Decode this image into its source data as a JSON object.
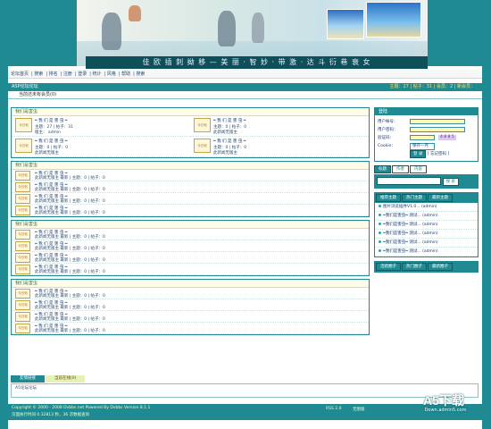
{
  "banner": {
    "slogan": "佳 欧 插 刺 拗 移 — 美 丽 · 智 妙 · 带 激 · 达 斗 衍 巷 衰 女"
  },
  "nav": {
    "items": [
      "论坛首页",
      "搜索",
      "排名",
      "注册",
      "登录",
      "统计",
      "风格",
      "帮助",
      "搜索"
    ]
  },
  "stats": {
    "text": "主题：27  |  帖子：31  |  会员：2  |  新会员："
  },
  "forum_bar": {
    "title": "ASP论坛论坛",
    "right": "今日：0  |  帖：28  |  最高日：40"
  },
  "online": {
    "text": "当前还未有会员(0)"
  },
  "sections": [
    {
      "title": "我们是害虫",
      "type": "grid",
      "cells": [
        {
          "icon": "今日帖",
          "title": "═ 我 们 是 害 虫 ═",
          "line2": "主题：27  |  帖子：31",
          "line3": "版主：  admin"
        },
        {
          "icon": "今日帖",
          "title": "═ 我 们 是 害 虫 ═",
          "line2": "主题：0  |  帖子：0",
          "line3": "此新闻无版主"
        },
        {
          "icon": "今日帖",
          "title": "═ 我 们 是 害 虫 ═",
          "line2": "主题：0  |  帖子：0",
          "line3": "此新闻无版主"
        },
        {
          "icon": "今日帖",
          "title": "═ 我 们 是 害 虫 ═",
          "line2": "主题：0  |  帖子：0",
          "line3": "此新闻无版主"
        }
      ]
    },
    {
      "title": "我们是害虫",
      "type": "rows",
      "rows": [
        {
          "icon": "今日帖",
          "title": "═ 我 们 是 害 虫 ═",
          "line2": "此新闻无版主    最新  |  主题：0  |  帖子：0"
        },
        {
          "icon": "今日帖",
          "title": "═ 我 们 是 害 虫 ═",
          "line2": "此新闻无版主    最新  |  主题：0  |  帖子：0"
        },
        {
          "icon": "今日帖",
          "title": "═ 我 们 是 害 虫 ═",
          "line2": "此新闻无版主    最新  |  主题：0  |  帖子：0"
        },
        {
          "icon": "今日帖",
          "title": "═ 我 们 是 害 虫 ═",
          "line2": "此新闻无版主    最新  |  主题：0  |  帖子：0"
        }
      ]
    },
    {
      "title": "我们是害虫",
      "type": "rows",
      "rows": [
        {
          "icon": "今日帖",
          "title": "═ 我 们 是 害 虫 ═",
          "line2": "此新闻无版主    最新  |  主题：0  |  帖子：0"
        },
        {
          "icon": "今日帖",
          "title": "═ 我 们 是 害 虫 ═",
          "line2": "此新闻无版主    最新  |  主题：0  |  帖子：0"
        },
        {
          "icon": "今日帖",
          "title": "═ 我 们 是 害 虫 ═",
          "line2": "此新闻无版主    最新  |  主题：0  |  帖子：0"
        },
        {
          "icon": "今日帖",
          "title": "═ 我 们 是 害 虫 ═",
          "line2": "此新闻无版主    最新  |  主题：0  |  帖子：0"
        }
      ]
    },
    {
      "title": "我们是害虫",
      "type": "rows",
      "rows": [
        {
          "icon": "今日帖",
          "title": "═ 我 们 是 害 虫 ═",
          "line2": "此新闻无版主    最新  |  主题：0  |  帖子：0"
        },
        {
          "icon": "今日帖",
          "title": "═ 我 们 是 害 虫 ═",
          "line2": "此新闻无版主    最新  |  主题：0  |  帖子：0"
        },
        {
          "icon": "今日帖",
          "title": "═ 我 们 是 害 虫 ═",
          "line2": "此新闻无版主    最新  |  主题：0  |  帖子：0"
        },
        {
          "icon": "今日帖",
          "title": "═ 我 们 是 害 虫 ═",
          "line2": "此新闻无版主    最新  |  主题：0  |  帖子：0"
        }
      ]
    }
  ],
  "login": {
    "title": "登陆",
    "username_label": "用户帐号：",
    "password_label": "用户密码：",
    "code_label": "验证码：",
    "code_value": "4 8 8 5",
    "cookie_label": "Cookie：",
    "cookie_value": "保存一月",
    "login_btn": "登 录",
    "forgot": "[ 忘记密码 ]"
  },
  "search": {
    "tabs": [
      "标题",
      "作者",
      "内容"
    ],
    "button": "搜 索"
  },
  "topics": {
    "tabs": [
      "推荐主题",
      "热门主题",
      "最新主题"
    ],
    "items": [
      "图片浏览插件V1.0... (admin)",
      "═我们是害虫═ 测试... (admin)",
      "═我们是害虫═ 测试... (admin)",
      "═我们是害虫═ 测试... (admin)",
      "═我们是害虫═ 测试... (admin)",
      "═我们是害虫═ 测试... (admin)"
    ]
  },
  "circles": {
    "tabs": [
      "活跃圈子",
      "热门圈子",
      "最新圈子"
    ]
  },
  "bottom_tabs": [
    "友情链接",
    "当前在线(0)"
  ],
  "info_text": "A5论坛论坛",
  "footer": {
    "line1": "Copyright © 2000 - 2008  Dvbbs.net   Powered By Dvbbs Version 8.1.1",
    "line2": "页面执行时间 0.32813 秒，36 次数据查询",
    "right1": "RSS 2.0",
    "right2": "无图版"
  },
  "watermark": {
    "logo": "A5下载",
    "url": "Down.admin5.com"
  }
}
